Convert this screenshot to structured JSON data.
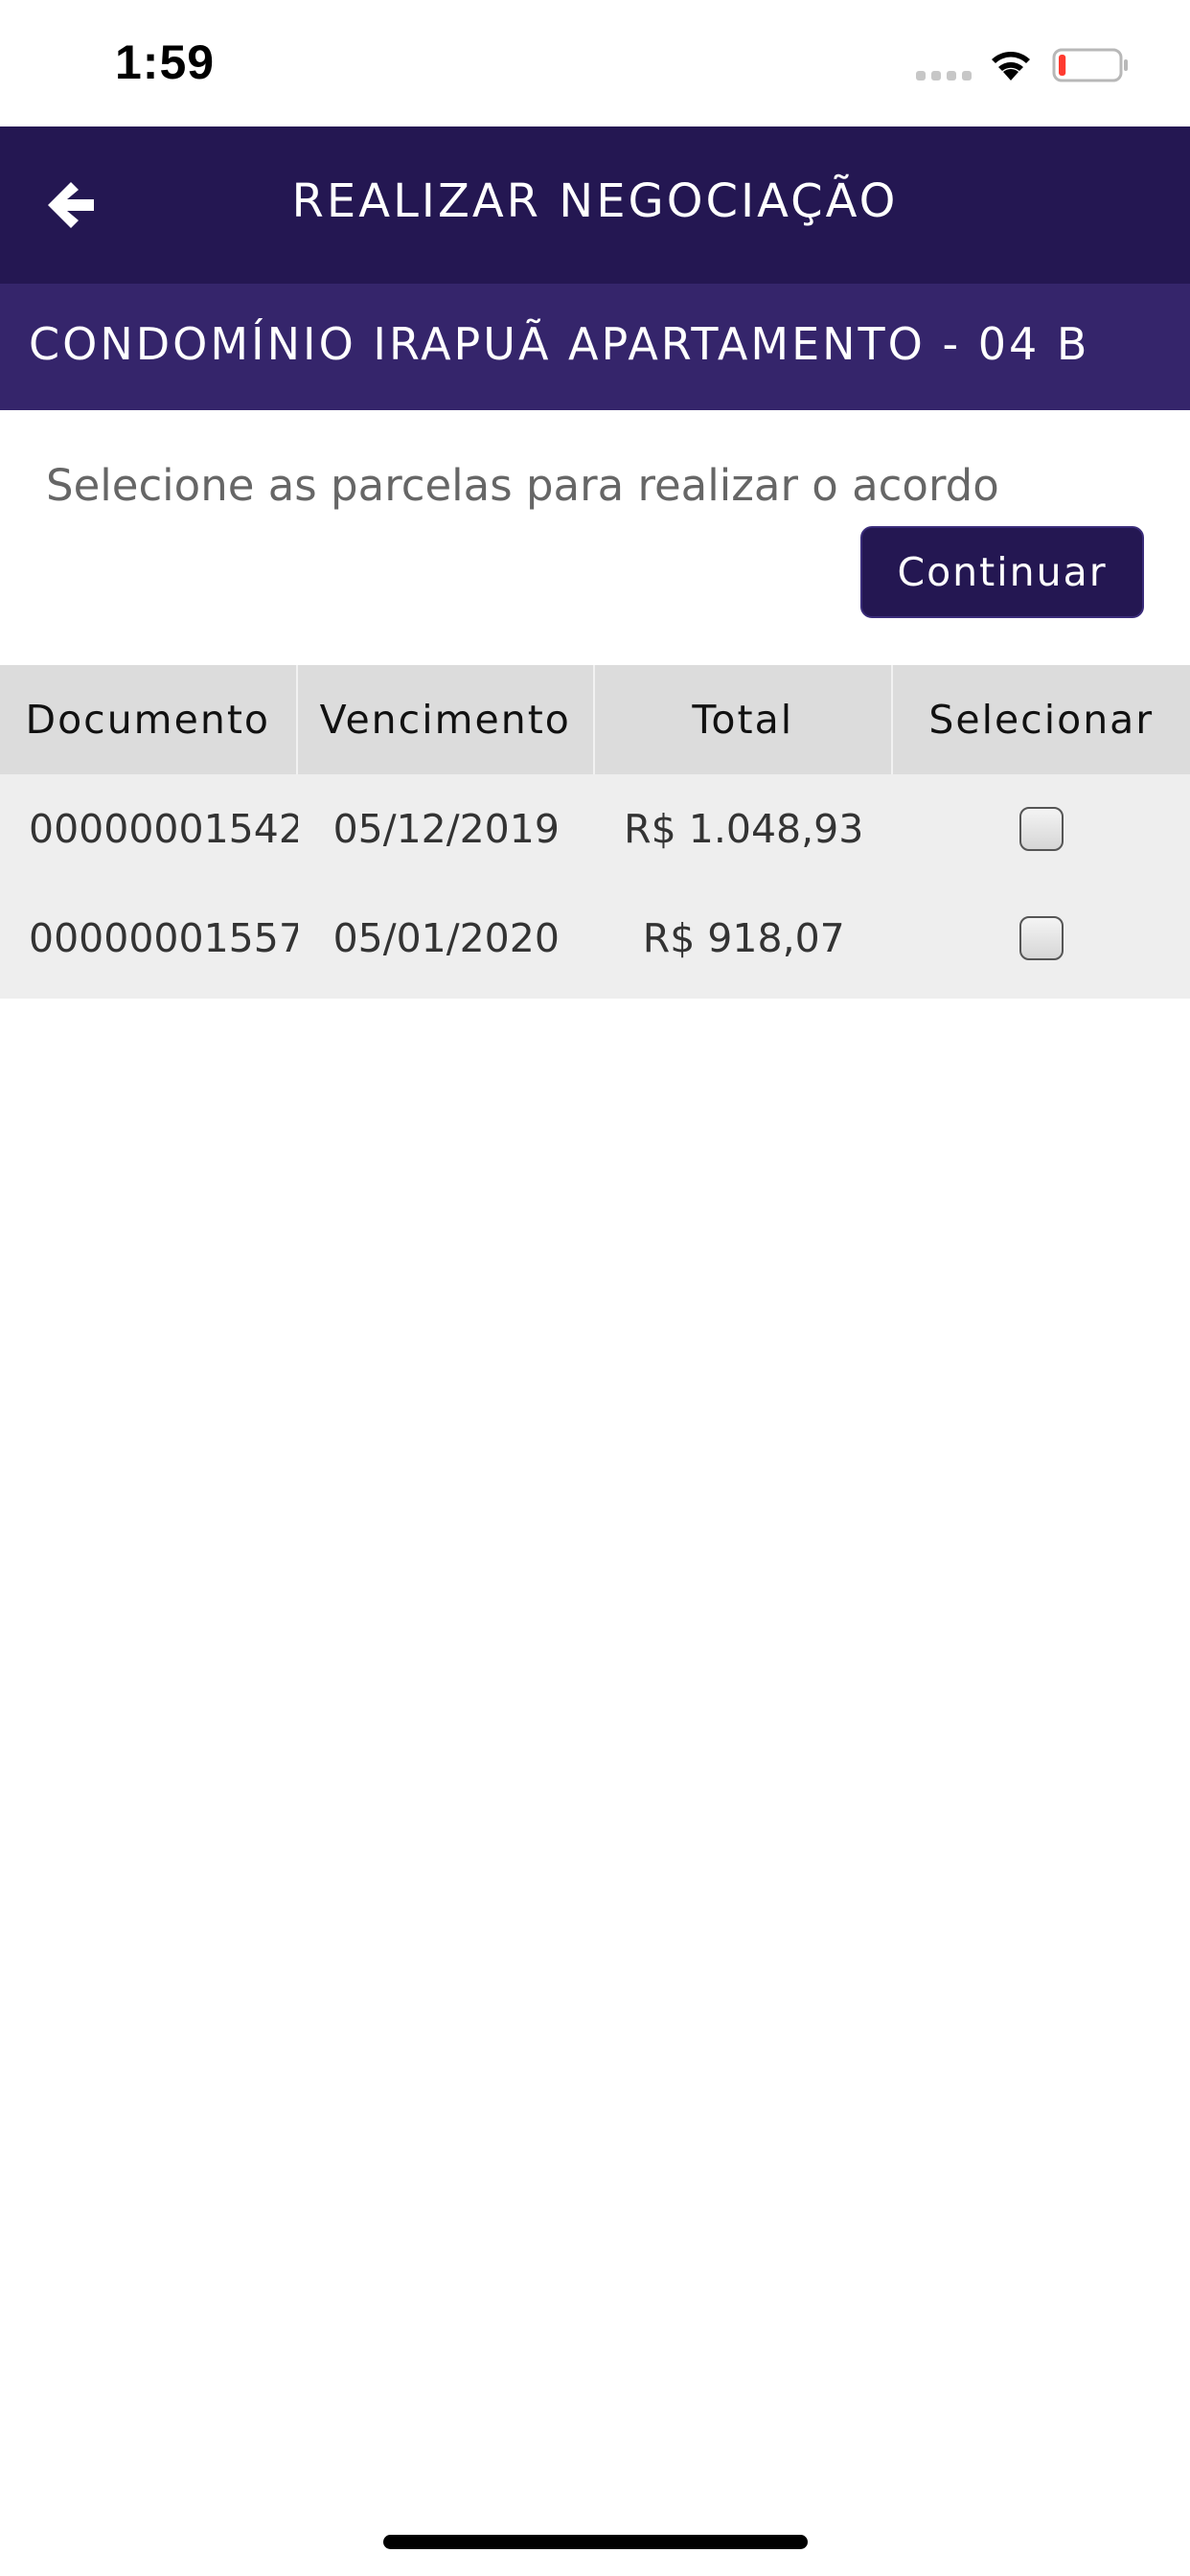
{
  "status_bar": {
    "time": "1:59",
    "icons": [
      "signal-dots-icon",
      "wifi-icon",
      "battery-low-icon"
    ],
    "battery_level": 0.12,
    "battery_color": "#ff3b30"
  },
  "header": {
    "title": "REALIZAR NEGOCIAÇÃO",
    "back_icon": "arrow-left-icon",
    "background": "#241752"
  },
  "subheader": {
    "title": "CONDOMÍNIO IRAPUÃ APARTAMENTO - 04 B",
    "background": "#35256b"
  },
  "instruction": "Selecione as parcelas para realizar o acordo",
  "continue_button": {
    "label": "Continuar"
  },
  "table": {
    "headers": [
      "Documento",
      "Vencimento",
      "Total",
      "Selecionar"
    ],
    "rows": [
      {
        "documento": "00000001542",
        "vencimento": "05/12/2019",
        "total": "R$ 1.048,93",
        "selected": false
      },
      {
        "documento": "00000001557",
        "vencimento": "05/01/2020",
        "total": "R$ 918,07",
        "selected": false
      }
    ]
  }
}
